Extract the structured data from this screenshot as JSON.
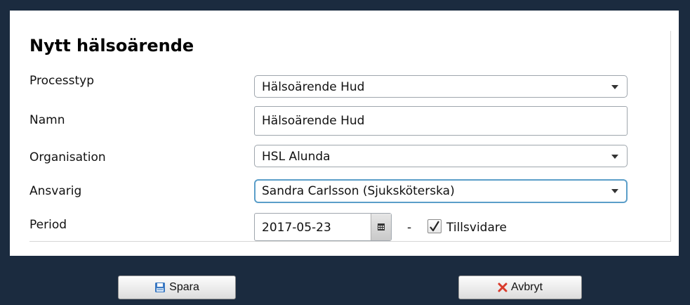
{
  "form": {
    "title": "Nytt hälsoärende",
    "fields": {
      "processtyp": {
        "label": "Processtyp",
        "value": "Hälsoärende Hud"
      },
      "namn": {
        "label": "Namn",
        "value": "Hälsoärende Hud"
      },
      "organisation": {
        "label": "Organisation",
        "value": "HSL Alunda"
      },
      "ansvarig": {
        "label": "Ansvarig",
        "value": "Sandra Carlsson (Sjuksköterska)"
      },
      "period": {
        "label": "Period",
        "start": "2017-05-23",
        "separator": "-",
        "checkbox_label": "Tillsvidare",
        "checked": true
      }
    }
  },
  "buttons": {
    "save": {
      "label": "Spara",
      "icon": "save-icon",
      "icon_color": "#3a78c2"
    },
    "cancel": {
      "label": "Avbryt",
      "icon": "close-icon",
      "icon_color": "#d93a2b"
    }
  },
  "colors": {
    "background": "#1b2b3f",
    "focus_border": "#5b9ec9"
  }
}
